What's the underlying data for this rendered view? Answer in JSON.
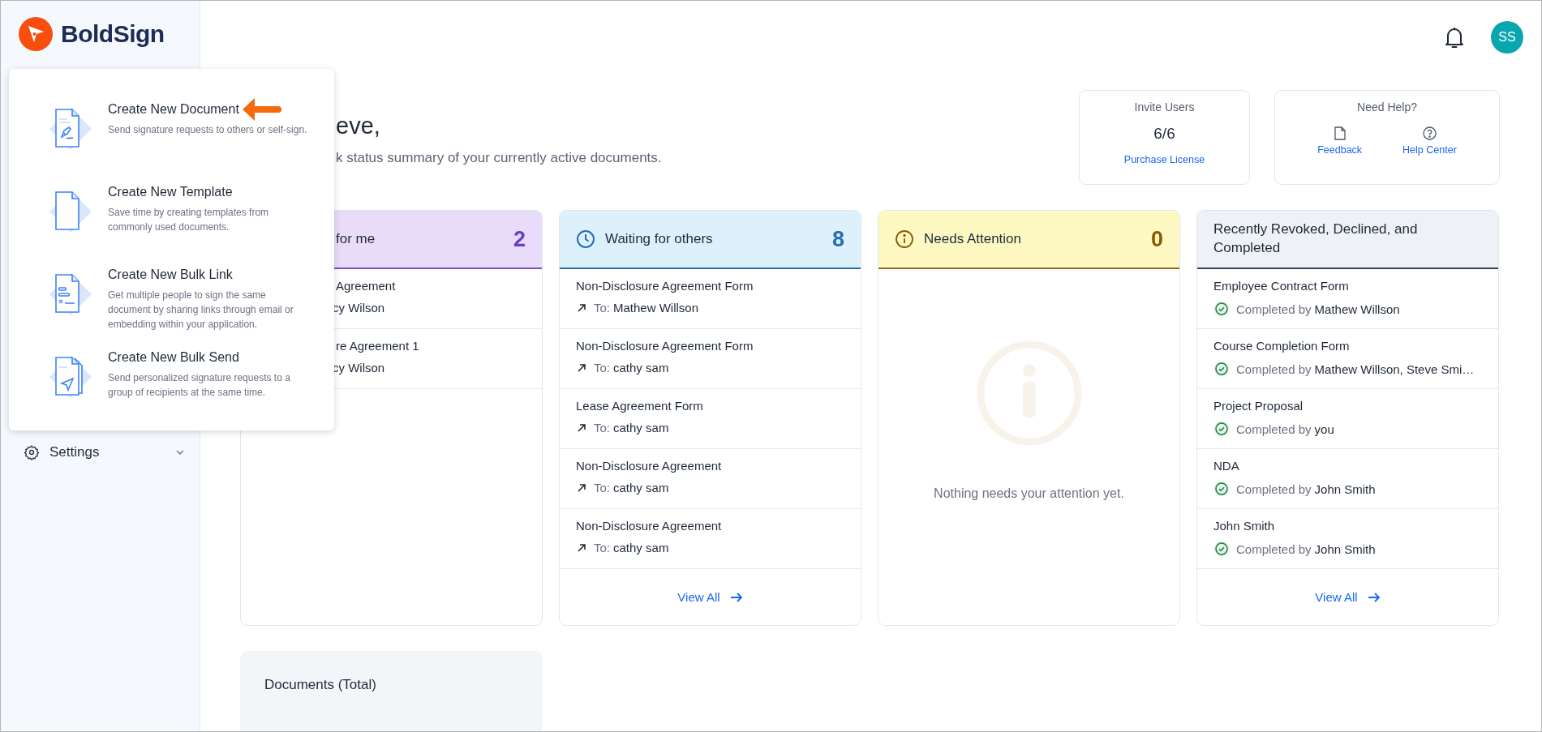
{
  "brand": {
    "name": "BoldSign"
  },
  "header": {
    "avatar_initials": "SS"
  },
  "sidebar": {
    "items": [
      {
        "label": "Settings",
        "expanded": false
      }
    ]
  },
  "create_menu": {
    "items": [
      {
        "kind": "document",
        "title": "Create New Document",
        "description": "Send signature requests to others or self-sign.",
        "pointed": true
      },
      {
        "kind": "template",
        "title": "Create New Template",
        "description": "Save time by creating templates from commonly used documents.",
        "pointed": false
      },
      {
        "kind": "bulk_link",
        "title": "Create New Bulk Link",
        "description": "Get multiple people to sign the same document by sharing links through email or embedding within your application.",
        "pointed": false
      },
      {
        "kind": "bulk_send",
        "title": "Create New Bulk Send",
        "description": "Send personalized signature requests to a group of recipients at the same time.",
        "pointed": false
      }
    ]
  },
  "greeting": {
    "title": "eve,",
    "subtitle": "k status summary of your currently active documents."
  },
  "invite": {
    "title": "Invite Users",
    "count": "6/6",
    "link": "Purchase License"
  },
  "help": {
    "title": "Need Help?",
    "links": [
      {
        "kind": "feedback",
        "label": "Feedback"
      },
      {
        "kind": "help",
        "label": "Help Center"
      }
    ]
  },
  "status_cards": [
    {
      "kind": "me",
      "title": "for me",
      "count": "2",
      "rows": [
        {
          "document": "Agreement",
          "person": "cy Wilson"
        },
        {
          "document": "re Agreement 1",
          "person": "cy Wilson"
        }
      ]
    },
    {
      "kind": "others",
      "title": "Waiting for others",
      "count": "8",
      "rows": [
        {
          "document": "Non-Disclosure Agreement Form",
          "prefix": "To:",
          "person": "Mathew Willson"
        },
        {
          "document": "Non-Disclosure Agreement Form",
          "prefix": "To:",
          "person": "cathy sam"
        },
        {
          "document": "Lease Agreement Form",
          "prefix": "To:",
          "person": "cathy sam"
        },
        {
          "document": "Non-Disclosure Agreement",
          "prefix": "To:",
          "person": "cathy sam"
        },
        {
          "document": "Non-Disclosure Agreement",
          "prefix": "To:",
          "person": "cathy sam"
        }
      ],
      "view_all": "View All"
    },
    {
      "kind": "attention",
      "title": "Needs Attention",
      "count": "0",
      "empty_message": "Nothing needs your attention yet."
    },
    {
      "kind": "completed",
      "title": "Recently Revoked, Declined, and Completed",
      "rows": [
        {
          "document": "Employee Contract Form",
          "prefix": "Completed by",
          "person": "Mathew Willson"
        },
        {
          "document": "Course Completion Form",
          "prefix": "Completed by",
          "person": "Mathew Willson, Steve Smi…"
        },
        {
          "document": "Project Proposal",
          "prefix": "Completed by",
          "person": "you"
        },
        {
          "document": "NDA",
          "prefix": "Completed by",
          "person": "John Smith"
        },
        {
          "document": "John Smith",
          "prefix": "Completed by",
          "person": "John Smith"
        }
      ],
      "view_all": "View All"
    }
  ],
  "documents_total": {
    "title": "Documents (Total)"
  }
}
